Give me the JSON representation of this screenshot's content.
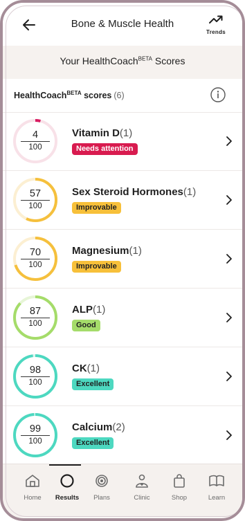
{
  "header": {
    "title": "Bone & Muscle Health",
    "trends_label": "Trends"
  },
  "banner": {
    "text": "Your HealthCoach",
    "sup": "BETA",
    "text_after": " Scores"
  },
  "scores": {
    "title": "HealthCoach",
    "sup": "BETA",
    "title_after": " scores",
    "count": "(6)"
  },
  "rows": [
    {
      "score": "4",
      "denominator": "100",
      "value": 0.04,
      "name": "Vitamin D",
      "count": "(1)",
      "badge": "Needs attention",
      "color": "#d81b60",
      "track": "#f8e1e8",
      "badge_bg": "#d81b4f",
      "badge_fg": "#ffffff"
    },
    {
      "score": "57",
      "denominator": "100",
      "value": 0.57,
      "name": "Sex Steroid Hormones",
      "count": "(1)",
      "badge": "Improvable",
      "color": "#f5c03d",
      "track": "#fcefd2",
      "badge_bg": "#f7c03a",
      "badge_fg": "#222222"
    },
    {
      "score": "70",
      "denominator": "100",
      "value": 0.7,
      "name": "Magnesium",
      "count": "(1)",
      "badge": "Improvable",
      "color": "#f5c03d",
      "track": "#fcefd2",
      "badge_bg": "#f7c03a",
      "badge_fg": "#222222"
    },
    {
      "score": "87",
      "denominator": "100",
      "value": 0.87,
      "name": "ALP",
      "count": "(1)",
      "badge": "Good",
      "color": "#a5dc6a",
      "track": "#e7f5d7",
      "badge_bg": "#a5dc6a",
      "badge_fg": "#222222"
    },
    {
      "score": "98",
      "denominator": "100",
      "value": 0.98,
      "name": "CK",
      "count": "(1)",
      "badge": "Excellent",
      "color": "#4dd8c0",
      "track": "#d9f5ef",
      "badge_bg": "#4dd8c0",
      "badge_fg": "#1f1f1f"
    },
    {
      "score": "99",
      "denominator": "100",
      "value": 0.99,
      "name": "Calcium",
      "count": "(2)",
      "badge": "Excellent",
      "color": "#4dd8c0",
      "track": "#d9f5ef",
      "badge_bg": "#4dd8c0",
      "badge_fg": "#1f1f1f"
    }
  ],
  "nav": [
    {
      "label": "Home",
      "icon": "home-icon"
    },
    {
      "label": "Results",
      "icon": "results-icon",
      "active": true
    },
    {
      "label": "Plans",
      "icon": "plans-icon"
    },
    {
      "label": "Clinic",
      "icon": "clinic-icon"
    },
    {
      "label": "Shop",
      "icon": "shop-icon"
    },
    {
      "label": "Learn",
      "icon": "learn-icon"
    }
  ]
}
